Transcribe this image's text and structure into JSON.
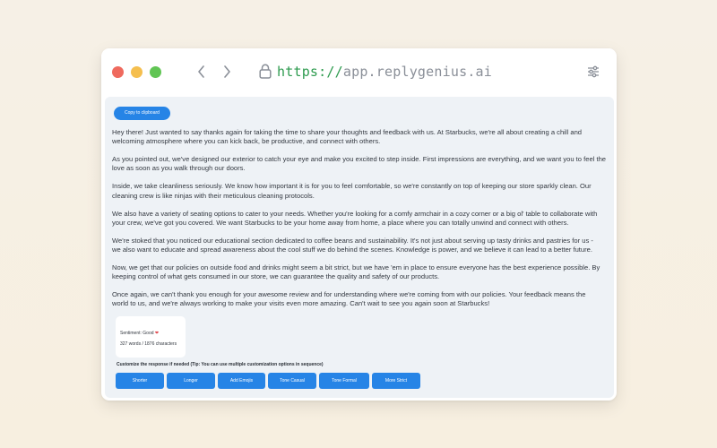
{
  "browser": {
    "url_scheme": "https://",
    "url_host": "app.replygenius.ai"
  },
  "toolbar": {
    "copy_label": "Copy to clipboard"
  },
  "response": {
    "paragraphs": [
      [
        "Hey there! Just wanted to say thanks again for taking the time to share your thoughts and feedback with us. At Starbucks, we're all about creating a chill and",
        "welcoming atmosphere where you can kick back, be productive, and connect with others."
      ],
      [
        "As you pointed out, we've designed our exterior to catch your eye and make you excited to step inside. First impressions are everything, and we want you to feel the",
        "love as soon as you walk through our doors."
      ],
      [
        "Inside, we take cleanliness seriously. We know how important it is for you to feel comfortable, so we're constantly on top of keeping our store sparkly clean. Our",
        "cleaning crew is like ninjas with their meticulous cleaning protocols."
      ],
      [
        "We also have a variety of seating options to cater to your needs. Whether you're looking for a comfy armchair in a cozy corner or a big ol' table to collaborate with",
        "your crew, we've got you covered. We want Starbucks to be your home away from home, a place where you can totally unwind and connect with others."
      ],
      [
        "We're stoked that you noticed our educational section dedicated to coffee beans and sustainability. It's not just about serving up tasty drinks and pastries for us -",
        "we also want to educate and spread awareness about the cool stuff we do behind the scenes. Knowledge is power, and we believe it can lead to a better future."
      ],
      [
        "Now, we get that our policies on outside food and drinks might seem a bit strict, but we have 'em in place to ensure everyone has the best experience possible. By",
        "keeping control of what gets consumed in our store, we can guarantee the quality and safety of our products."
      ],
      [
        "Once again, we can't thank you enough for your awesome review and for understanding where we're coming from with our policies. Your feedback means the",
        "world to us, and we're always working to make your visits even more amazing. Can't wait to see you again soon at Starbucks!"
      ]
    ]
  },
  "stats": {
    "sentiment": "Sentiment: Good",
    "heart_icon": "heart-icon",
    "counts": "327 words / 1876 characters"
  },
  "customize": {
    "hint": "Customize the response if needed  (Tip: You can use multiple customization options in sequence)",
    "buttons": [
      "Shorter",
      "Longer",
      "Add Emojis",
      "Tone Casual",
      "Tone Formal",
      "More Strict"
    ]
  },
  "colors": {
    "accent": "#2684e6",
    "url_scheme": "#2e9b4f",
    "close": "#ef6a5e",
    "minimize": "#f5bf4f",
    "maximize": "#61c554"
  }
}
